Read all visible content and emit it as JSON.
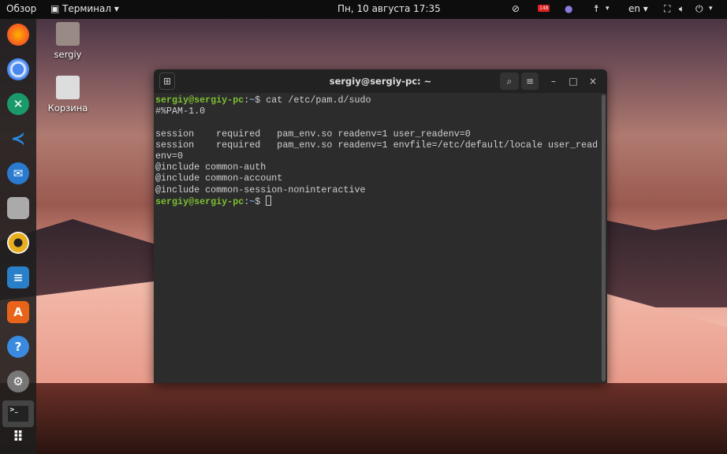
{
  "topbar": {
    "overview": "Обзор",
    "app_menu": "Терминал ▾",
    "clock": "Пн, 10 августа  17:35",
    "badge": "148",
    "lang": "en ▾",
    "a11y": "▾",
    "power": "▾"
  },
  "desktop": {
    "home": "sergiy",
    "trash": "Корзина"
  },
  "dock": [
    "firefox",
    "chromium",
    "crossover",
    "vscode",
    "thunderbird",
    "files",
    "rhythmbox",
    "libreoffice-writer",
    "software",
    "help",
    "settings",
    "terminal",
    "apps-grid"
  ],
  "terminal": {
    "title": "sergiy@sergiy-pc: ~",
    "prompt_user": "sergiy@sergiy-pc",
    "prompt_path": "~",
    "prompt_sign": "$ ",
    "command": "cat /etc/pam.d/sudo",
    "output": [
      "#%PAM-1.0",
      "",
      "session    required   pam_env.so readenv=1 user_readenv=0",
      "session    required   pam_env.so readenv=1 envfile=/etc/default/locale user_read",
      "env=0",
      "@include common-auth",
      "@include common-account",
      "@include common-session-noninteractive"
    ]
  }
}
